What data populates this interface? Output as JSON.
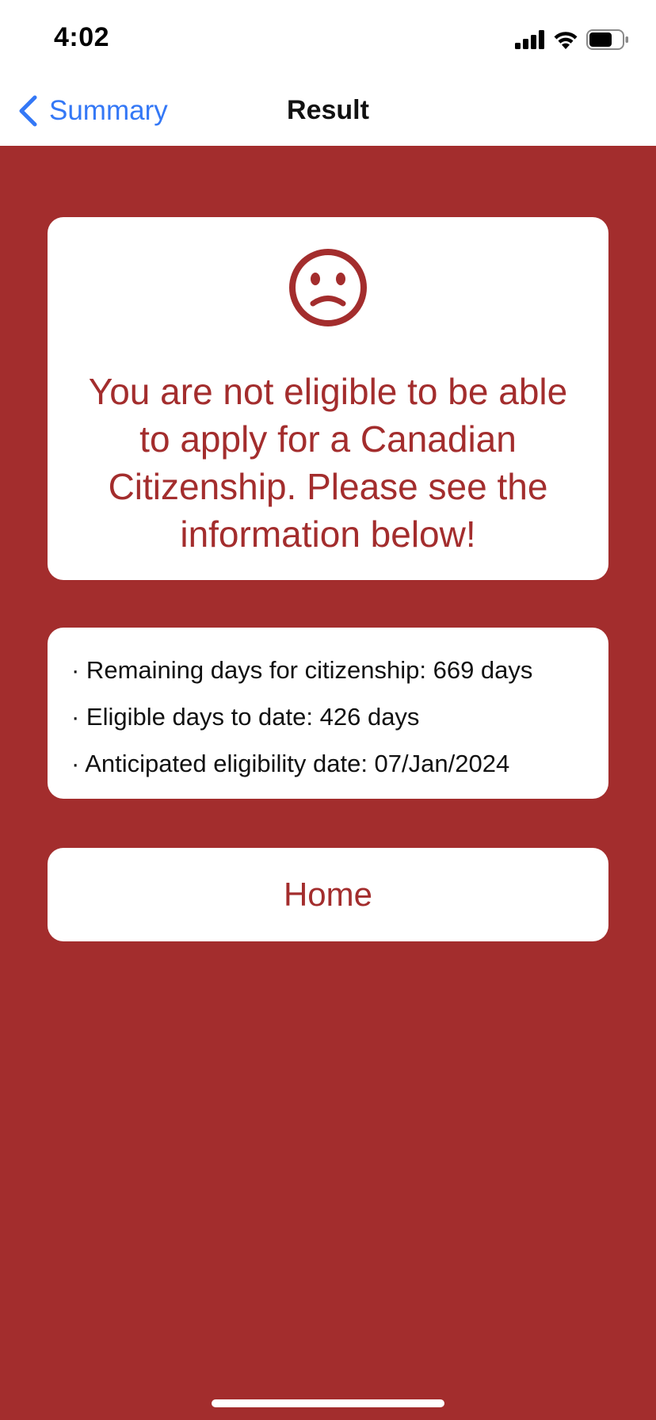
{
  "status_bar": {
    "time": "4:02"
  },
  "nav": {
    "back_label": "Summary",
    "title": "Result",
    "accent_color": "#3478f6"
  },
  "theme": {
    "background_color": "#a32d2d",
    "text_accent_color": "#a32d2d"
  },
  "result": {
    "icon": "sad-face-icon",
    "message": "You are not eligible to be able to apply for a Canadian Citizenship. Please see the information below!"
  },
  "info": {
    "items": [
      "· Remaining days for citizenship: 669 days",
      "· Eligible days to date: 426 days",
      "· Anticipated eligibility date: 07/Jan/2024"
    ]
  },
  "home_button": {
    "label": "Home"
  }
}
